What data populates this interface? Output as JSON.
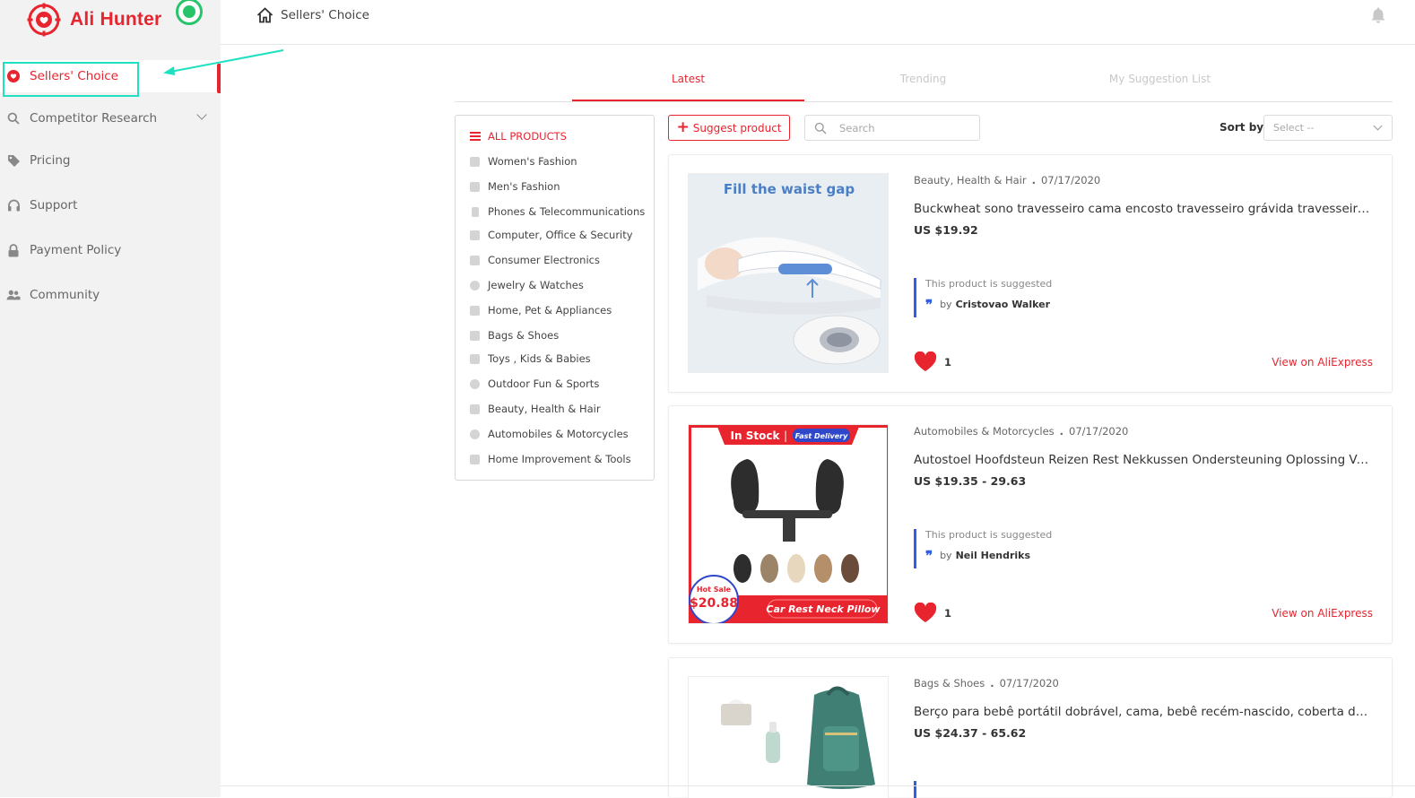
{
  "app": {
    "name": "Ali Hunter",
    "brand_color": "#e8242f",
    "online_status_color": "#27c46b"
  },
  "sidebar": {
    "items": [
      {
        "label": "Sellers' Choice",
        "icon": "heart-icon",
        "active": true
      },
      {
        "label": "Competitor Research",
        "icon": "search-icon",
        "expandable": true
      },
      {
        "label": "Pricing",
        "icon": "tag-icon"
      },
      {
        "label": "Support",
        "icon": "headset-icon"
      },
      {
        "label": "Payment Policy",
        "icon": "lock-icon"
      },
      {
        "label": "Community",
        "icon": "users-icon"
      }
    ]
  },
  "header": {
    "breadcrumb": "Sellers' Choice"
  },
  "tabs": [
    {
      "label": "Latest",
      "active": true
    },
    {
      "label": "Trending"
    },
    {
      "label": "My Suggestion List"
    }
  ],
  "categories": [
    "ALL PRODUCTS",
    "Women's Fashion",
    "Men's Fashion",
    "Phones & Telecommunications",
    "Computer, Office & Security",
    "Consumer Electronics",
    "Jewelry & Watches",
    "Home, Pet & Appliances",
    "Bags & Shoes",
    "Toys , Kids & Babies",
    "Outdoor Fun & Sports",
    "Beauty, Health & Hair",
    "Automobiles & Motorcycles",
    "Home Improvement & Tools"
  ],
  "toolbar": {
    "suggest_label": "Suggest product",
    "search_placeholder": "Search",
    "sort_label": "Sort by",
    "sort_value": "Select --"
  },
  "suggestion_note": "This product is suggested",
  "by_label": "by",
  "view_label": "View on AliExpress",
  "products": [
    {
      "category": "Beauty, Health & Hair",
      "date": "07/17/2020",
      "title": "Buckwheat sono travesseiro cama encosto travesseiro grávida travesseiro cintura lombar",
      "price": "US $19.92",
      "suggested_by": "Cristovao Walker",
      "likes": "1",
      "image_caption": "Fill the waist gap"
    },
    {
      "category": "Automobiles & Motorcycles",
      "date": "07/17/2020",
      "title": "Autostoel Hoofdsteun Reizen Rest Nekkussen Ondersteuning Oplossing Voor Kinderen",
      "price": "US $19.35 - 29.63",
      "suggested_by": "Neil Hendriks",
      "likes": "1",
      "image_banner_left": "In Stock",
      "image_banner_right": "Fast Delivery",
      "image_sale_label": "Hot Sale",
      "image_sale_price": "$20.88",
      "image_caption": "Car Rest Neck Pillow"
    },
    {
      "category": "Bags & Shoes",
      "date": "07/17/2020",
      "title": "Berço para bebê portátil dobrável, cama, bebê recém-nascido, coberta de viagem",
      "price": "US $24.37 - 65.62"
    }
  ]
}
